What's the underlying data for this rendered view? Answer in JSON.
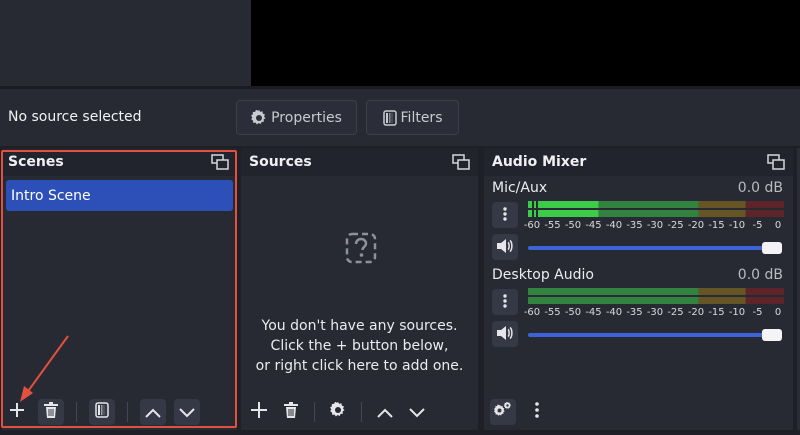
{
  "context_bar": {
    "status": "No source selected",
    "properties_label": "Properties",
    "filters_label": "Filters"
  },
  "scenes": {
    "title": "Scenes",
    "items": [
      {
        "label": "Intro Scene",
        "selected": true
      }
    ]
  },
  "sources": {
    "title": "Sources",
    "empty_lines": [
      "You don't have any sources.",
      "Click the + button below,",
      "or right click here to add one."
    ]
  },
  "audio_mixer": {
    "title": "Audio Mixer",
    "channels": [
      {
        "name": "Mic/Aux",
        "level": "0.0 dB",
        "volume": 1.0
      },
      {
        "name": "Desktop Audio",
        "level": "0.0 dB",
        "volume": 1.0
      }
    ],
    "ticks": [
      "-60",
      "-55",
      "-50",
      "-45",
      "-40",
      "-35",
      "-30",
      "-25",
      "-20",
      "-15",
      "-10",
      "-5",
      "0"
    ]
  },
  "colors": {
    "accent": "#2d4fb8",
    "highlight": "#e0513e",
    "meter_green": "#3dcc49",
    "meter_yellow": "#9a7a1c",
    "meter_red": "#8a2020"
  },
  "icons": {
    "properties": "gear-icon",
    "filters": "filter-icon",
    "undock": "undock-icon",
    "add": "plus-icon",
    "remove": "trash-icon",
    "scene_filters": "filter-icon",
    "move_up": "chevron-up-icon",
    "move_down": "chevron-down-icon",
    "source_properties": "gear-icon",
    "empty": "question-icon",
    "mixer_menu": "vertical-dots-icon",
    "mute": "speaker-icon",
    "advanced_audio": "gears-icon"
  }
}
